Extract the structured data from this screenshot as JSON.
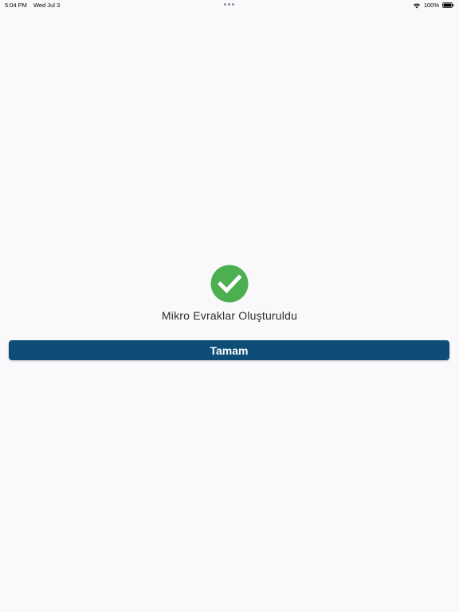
{
  "status_bar": {
    "time": "5:04 PM",
    "date": "Wed Jul 3",
    "battery": "100%",
    "icons": [
      "wifi-icon",
      "battery-icon"
    ]
  },
  "dialog": {
    "icon": "check-circle-icon",
    "icon_color": "#4caf50",
    "message": "Mikro Evraklar Oluşturuldu",
    "ok_label": "Tamam",
    "button_color": "#0d4d77"
  }
}
